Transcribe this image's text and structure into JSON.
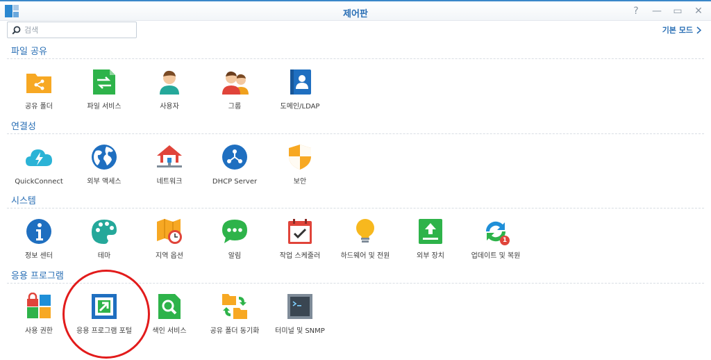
{
  "window": {
    "title": "제어판"
  },
  "search": {
    "placeholder": "검색"
  },
  "header": {
    "mode_link": "기본 모드"
  },
  "sections": [
    {
      "title": "파일 공유",
      "items": [
        "공유 폴더",
        "파일 서비스",
        "사용자",
        "그룹",
        "도메인/LDAP"
      ]
    },
    {
      "title": "연결성",
      "items": [
        "QuickConnect",
        "외부 액세스",
        "네트워크",
        "DHCP Server",
        "보안"
      ]
    },
    {
      "title": "시스템",
      "items": [
        "정보 센터",
        "테마",
        "지역 옵션",
        "알림",
        "작업 스케줄러",
        "하드웨어 및 전원",
        "외부 장치",
        "업데이트 및 복원"
      ]
    },
    {
      "title": "응용 프로그램",
      "items": [
        "사용 권한",
        "응용 프로그램 포털",
        "색인 서비스",
        "공유 폴더 동기화",
        "터미널 및 SNMP"
      ]
    }
  ],
  "badges": {
    "update_count": "1"
  },
  "colors": {
    "accent": "#2a6fb5",
    "highlight": "#e21b1b"
  }
}
